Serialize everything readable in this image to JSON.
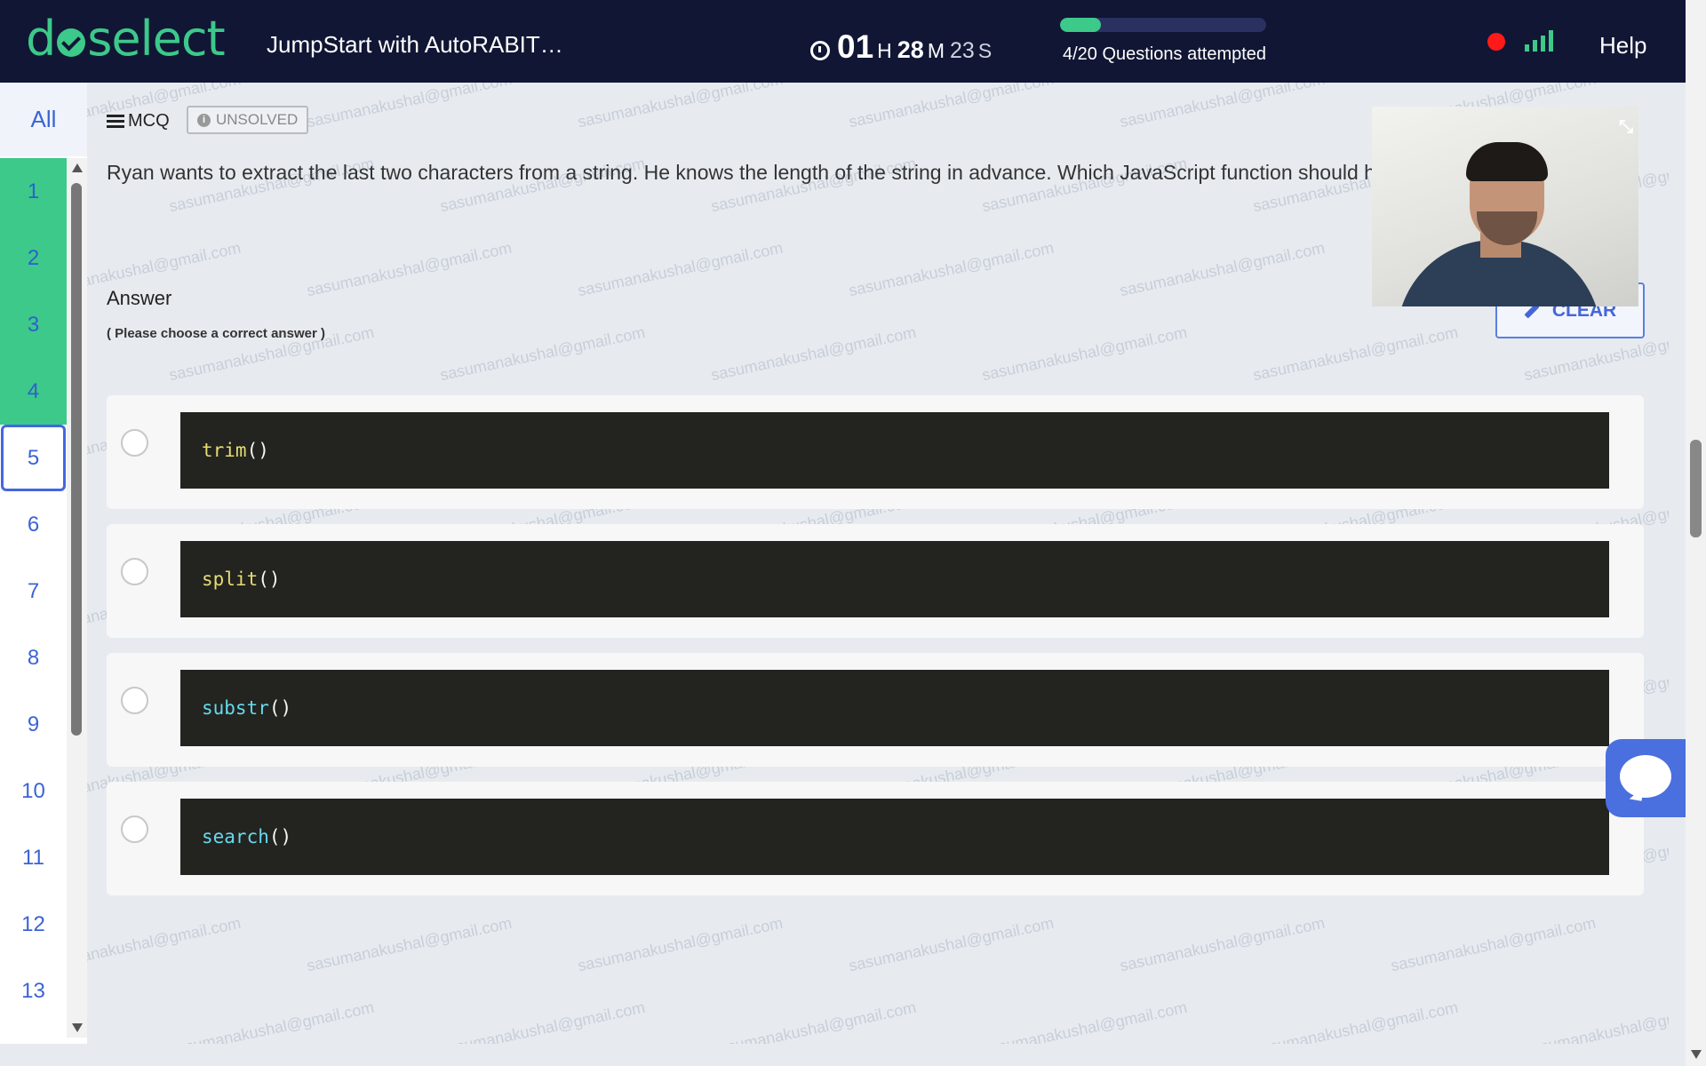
{
  "header": {
    "logo_left": "d",
    "logo_right": "select",
    "test_title": "JumpStart with AutoRABIT…",
    "timer": {
      "hours": "01",
      "hours_unit": "H",
      "minutes": "28",
      "minutes_unit": "M",
      "seconds": "23",
      "seconds_unit": "S"
    },
    "progress": {
      "attempted": 4,
      "total": 20,
      "fraction": 0.2,
      "label": "4/20 Questions attempted"
    },
    "help_label": "Help",
    "colors": {
      "bar": "#111634",
      "accent": "#3cc98a",
      "recording": "#ff1a1a"
    }
  },
  "sidebar": {
    "all_label": "All",
    "questions": [
      {
        "label": "1",
        "state": "attempted"
      },
      {
        "label": "2",
        "state": "attempted"
      },
      {
        "label": "3",
        "state": "attempted"
      },
      {
        "label": "4",
        "state": "attempted"
      },
      {
        "label": "5",
        "state": "current"
      },
      {
        "label": "6",
        "state": "unattempted"
      },
      {
        "label": "7",
        "state": "unattempted"
      },
      {
        "label": "8",
        "state": "unattempted"
      },
      {
        "label": "9",
        "state": "unattempted"
      },
      {
        "label": "10",
        "state": "unattempted"
      },
      {
        "label": "11",
        "state": "unattempted"
      },
      {
        "label": "12",
        "state": "unattempted"
      },
      {
        "label": "13",
        "state": "unattempted"
      }
    ]
  },
  "question": {
    "type_label": "MCQ",
    "status_label": "UNSOLVED",
    "text": "Ryan wants to extract the last two characters from a string. He knows the length of the string in advance. Which JavaScript function should he u",
    "answer_heading": "Answer",
    "answer_hint": "( Please choose a correct answer )",
    "clear_label": "CLEAR"
  },
  "options": [
    {
      "fn": "trim",
      "parens": "()",
      "color": "yellow"
    },
    {
      "fn": "split",
      "parens": "()",
      "color": "yellow"
    },
    {
      "fn": "substr",
      "parens": "()",
      "color": "blue"
    },
    {
      "fn": "search",
      "parens": "()",
      "color": "blue"
    }
  ],
  "watermark": "sasumanakushal@gmail.com",
  "icons": [
    "clock-icon",
    "signal-icon",
    "recording-dot-icon",
    "list-icon",
    "info-icon",
    "pencil-icon",
    "minimize-icon",
    "chat-icon"
  ]
}
